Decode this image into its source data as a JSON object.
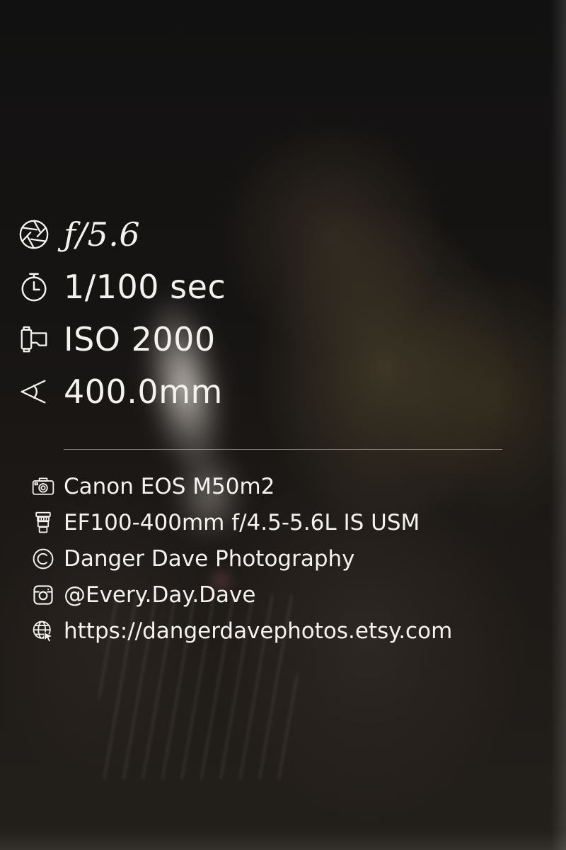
{
  "exif": {
    "aperture": "ƒ/5.6",
    "shutter": "1/100 sec",
    "iso": "ISO 2000",
    "focal_length": "400.0mm"
  },
  "info": {
    "camera": "Canon EOS M50m2",
    "lens": "EF100-400mm f/4.5-5.6L IS USM",
    "copyright": "Danger Dave Photography",
    "instagram": "@Every.Day.Dave",
    "website": "https://dangerdavephotos.etsy.com"
  },
  "icons": {
    "aperture": "aperture-icon",
    "shutter": "stopwatch-icon",
    "iso": "film-canister-icon",
    "focal_length": "field-of-view-icon",
    "camera": "camera-icon",
    "lens": "lens-icon",
    "copyright": "copyright-icon",
    "instagram": "instagram-icon",
    "website": "globe-cursor-icon"
  },
  "colors": {
    "text": "#f4f2ee",
    "divider": "#cdc8c4",
    "background": "#151311"
  }
}
